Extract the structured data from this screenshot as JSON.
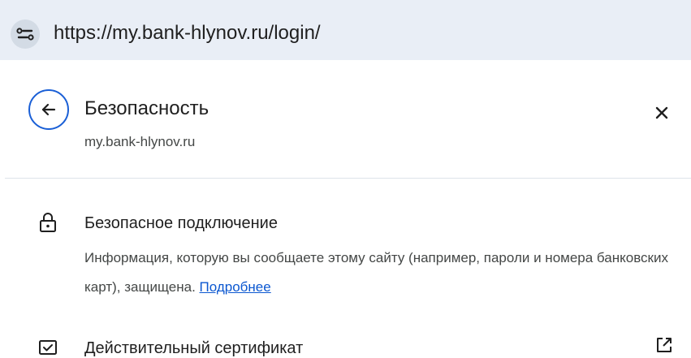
{
  "address_bar": {
    "url": "https://my.bank-hlynov.ru/login/",
    "site_info_icon": "tune-icon"
  },
  "panel": {
    "back_icon": "arrow-left-icon",
    "title": "Безопасность",
    "subtitle": "my.bank-hlynov.ru",
    "close_icon": "close-icon",
    "connection": {
      "icon": "lock-icon",
      "title": "Безопасное подключение",
      "description": "Информация, которую вы сообщаете этому сайту (например, пароли и номера банковских карт), защищена.",
      "link_text": "Подробнее"
    },
    "certificate": {
      "icon": "certificate-icon",
      "title": "Действительный сертификат",
      "action_icon": "open-in-new-icon"
    }
  },
  "colors": {
    "address_bar_bg": "#e9eef6",
    "accent": "#1a5fd6",
    "link": "#0b57d0",
    "text_primary": "#1f1f1f",
    "text_secondary": "#444746",
    "divider": "#dde3ea"
  }
}
